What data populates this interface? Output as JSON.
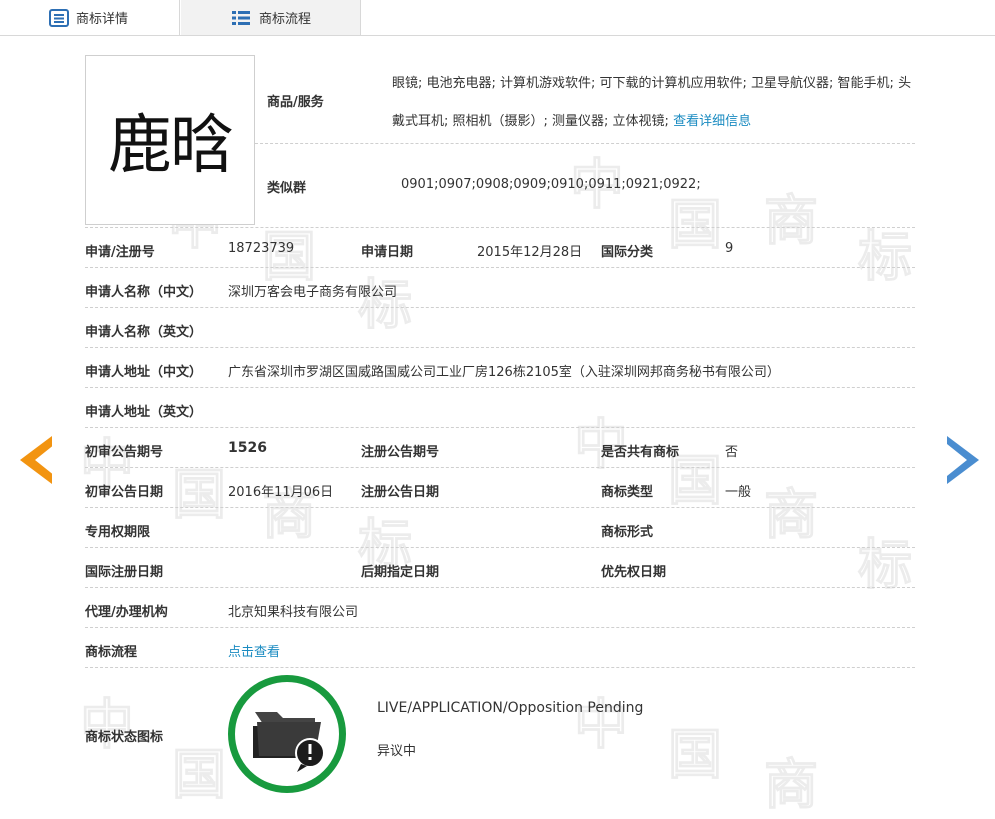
{
  "tabs": [
    {
      "label": "商标详情",
      "active": true
    },
    {
      "label": "商标流程",
      "active": false
    }
  ],
  "watermark": {
    "glyphs": [
      "中",
      "国",
      "商",
      "标"
    ]
  },
  "trademark": {
    "logo_text": "鹿晗",
    "goods_label": "商品/服务",
    "goods_value": "眼镜; 电池充电器; 计算机游戏软件; 可下载的计算机应用软件; 卫星导航仪器; 智能手机; 头戴式耳机; 照相机（摄影）; 测量仪器; 立体视镜;",
    "goods_link": "查看详细信息",
    "similar_label": "类似群",
    "similar_value": "0901;0907;0908;0909;0910;0911;0921;0922;"
  },
  "rows": {
    "reg_no_label": "申请/注册号",
    "reg_no": "18723739",
    "apply_date_label": "申请日期",
    "apply_date": "2015年12月28日",
    "intl_class_label": "国际分类",
    "intl_class": "9",
    "applicant_cn_label": "申请人名称（中文）",
    "applicant_cn": "深圳万客会电子商务有限公司",
    "applicant_en_label": "申请人名称（英文）",
    "applicant_en": "",
    "address_cn_label": "申请人地址（中文）",
    "address_cn": "广东省深圳市罗湖区国威路国威公司工业厂房126栋2105室（入驻深圳网邦商务秘书有限公司）",
    "address_en_label": "申请人地址（英文）",
    "address_en": "",
    "prelim_no_label": "初审公告期号",
    "prelim_no": "1526",
    "reg_pub_no_label": "注册公告期号",
    "reg_pub_no": "",
    "shared_label": "是否共有商标",
    "shared": "否",
    "prelim_date_label": "初审公告日期",
    "prelim_date": "2016年11月06日",
    "reg_pub_date_label": "注册公告日期",
    "reg_pub_date": "",
    "tm_type_label": "商标类型",
    "tm_type": "一般",
    "exclusive_label": "专用权期限",
    "exclusive": "",
    "tm_form_label": "商标形式",
    "tm_form": "",
    "intl_reg_date_label": "国际注册日期",
    "intl_reg_date": "",
    "later_date_label": "后期指定日期",
    "later_date": "",
    "priority_date_label": "优先权日期",
    "priority_date": "",
    "agent_label": "代理/办理机构",
    "agent": "北京知果科技有限公司",
    "process_label": "商标流程",
    "process_link": "点击查看",
    "status_label": "商标状态图标",
    "status_en": "LIVE/APPLICATION/Opposition Pending",
    "status_cn": "异议中"
  },
  "colors": {
    "accent_link": "#1a8bc1",
    "status_ring": "#189a3e",
    "arrow_left": "#f29411",
    "arrow_right": "#4a8dd0"
  },
  "icons": {
    "tab1": "document-list-icon",
    "tab2": "list-icon",
    "status": "folder-warning-icon"
  }
}
